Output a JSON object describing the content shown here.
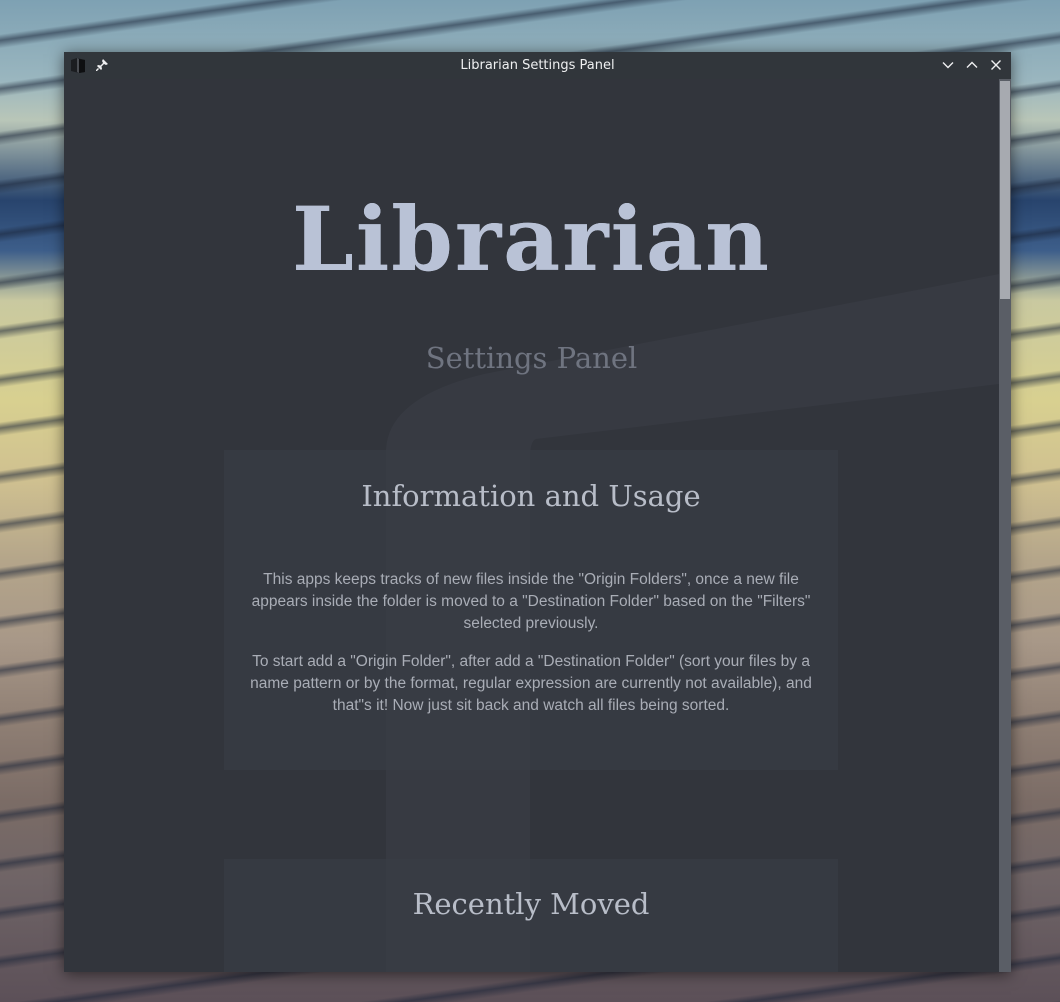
{
  "window": {
    "title": "Librarian Settings Panel",
    "controls": [
      "minimize",
      "maximize",
      "close"
    ]
  },
  "header": {
    "logo": "Librarian",
    "subtitle": "Settings Panel"
  },
  "info": {
    "heading": "Information and Usage",
    "paragraph1": "This apps keeps tracks of new files inside the \"Origin Folders\", once a new file appears inside the folder is moved to a \"Destination Folder\" based on the \"Filters\" selected previously.",
    "paragraph2": "To start add a \"Origin Folder\", after add a \"Destination Folder\" (sort your files by a name pattern or by the format, regular expression are currently not available), and that\"s it! Now just sit back and watch all files being sorted."
  },
  "recent": {
    "heading": "Recently Moved"
  },
  "icons": {
    "app": "book-icon",
    "pin": "pin-icon",
    "minimize": "chevron-down-icon",
    "maximize": "chevron-up-icon",
    "close": "close-icon"
  },
  "colors": {
    "window_bg": "#32353c",
    "logo": "#b9c2d6",
    "card_bg": "#3a3e47"
  }
}
